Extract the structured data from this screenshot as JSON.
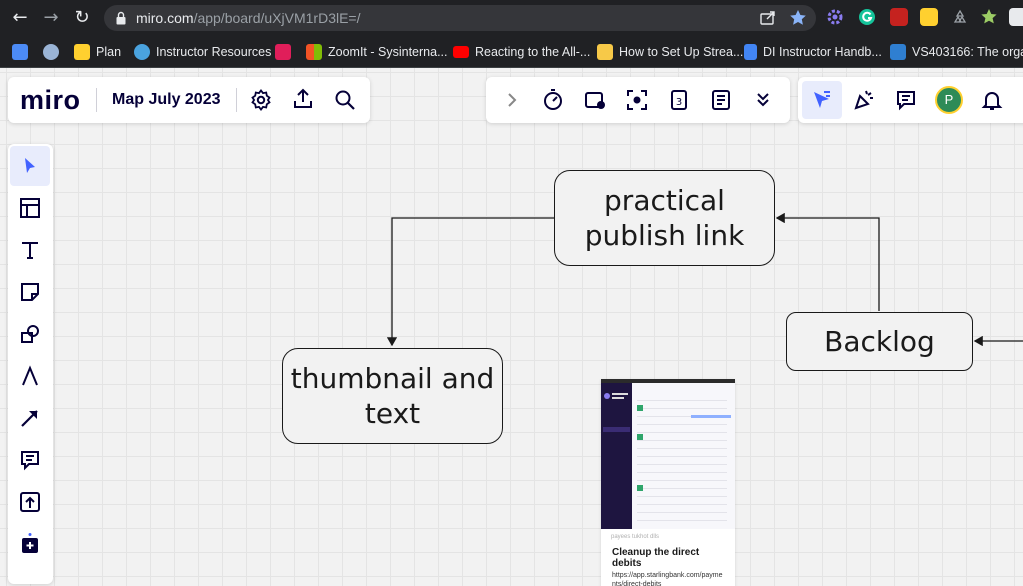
{
  "browser": {
    "url_host": "miro.com",
    "url_path": "/app/board/uXjVM1rD3lE=/"
  },
  "bookmarks": [
    {
      "label": "",
      "icon": "bookmarks-icon",
      "color": "#4c8bf5"
    },
    {
      "label": "",
      "icon": "wordpress-icon",
      "color": "#9ab4d6"
    },
    {
      "label": "Plan",
      "icon": "miro-icon",
      "color": "#ffd02f"
    },
    {
      "label": "Instructor Resources",
      "icon": "salesforce-icon",
      "color": "#4aa3df"
    },
    {
      "label": "",
      "icon": "slack-icon",
      "color": "#e01e5a"
    },
    {
      "label": "ZoomIt - Sysinterna...",
      "icon": "microsoft-icon",
      "color": "#f35325"
    },
    {
      "label": "Reacting to the All-...",
      "icon": "youtube-icon",
      "color": "#ff0000"
    },
    {
      "label": "How to Set Up Strea...",
      "icon": "stream-icon",
      "color": "#f7c948"
    },
    {
      "label": "DI Instructor Handb...",
      "icon": "docs-icon",
      "color": "#4285f4"
    },
    {
      "label": "VS403166: The orga...",
      "icon": "azure-icon",
      "color": "#2f7fd1"
    }
  ],
  "miro": {
    "logo": "miro",
    "board_title": "Map July 2023"
  },
  "colors": {
    "accent": "#4262ff",
    "active_tool_bg": "#e8ecfc",
    "avatar": "#2e8b57",
    "ink": "#050038"
  },
  "user": {
    "avatar_initial": "P"
  },
  "toolbar_right": {
    "collapse_icon": "chevron-right-icon",
    "icons": [
      "timer-icon",
      "screen-share-icon",
      "focus-icon",
      "calendar-3-icon",
      "notes-icon",
      "double-chevron-down-icon"
    ]
  },
  "collab": {
    "icons": [
      "cursor-follow-icon",
      "celebrate-icon",
      "comment-icon",
      "avatar-icon",
      "bell-icon"
    ]
  },
  "left_tools": [
    "select-icon",
    "template-icon",
    "text-icon",
    "sticky-note-icon",
    "shapes-icon",
    "pen-icon",
    "arrow-icon",
    "comment-icon",
    "upload-icon",
    "more-apps-icon"
  ],
  "board": {
    "nodes": {
      "practical": "practical publish link",
      "thumbnail": "thumbnail and text",
      "backlog": "Backlog"
    },
    "card": {
      "meta": "payees tukhot dlls",
      "title": "Cleanup the direct debits",
      "url": "https://app.starlingbank.com/payments/direct-debits"
    }
  }
}
